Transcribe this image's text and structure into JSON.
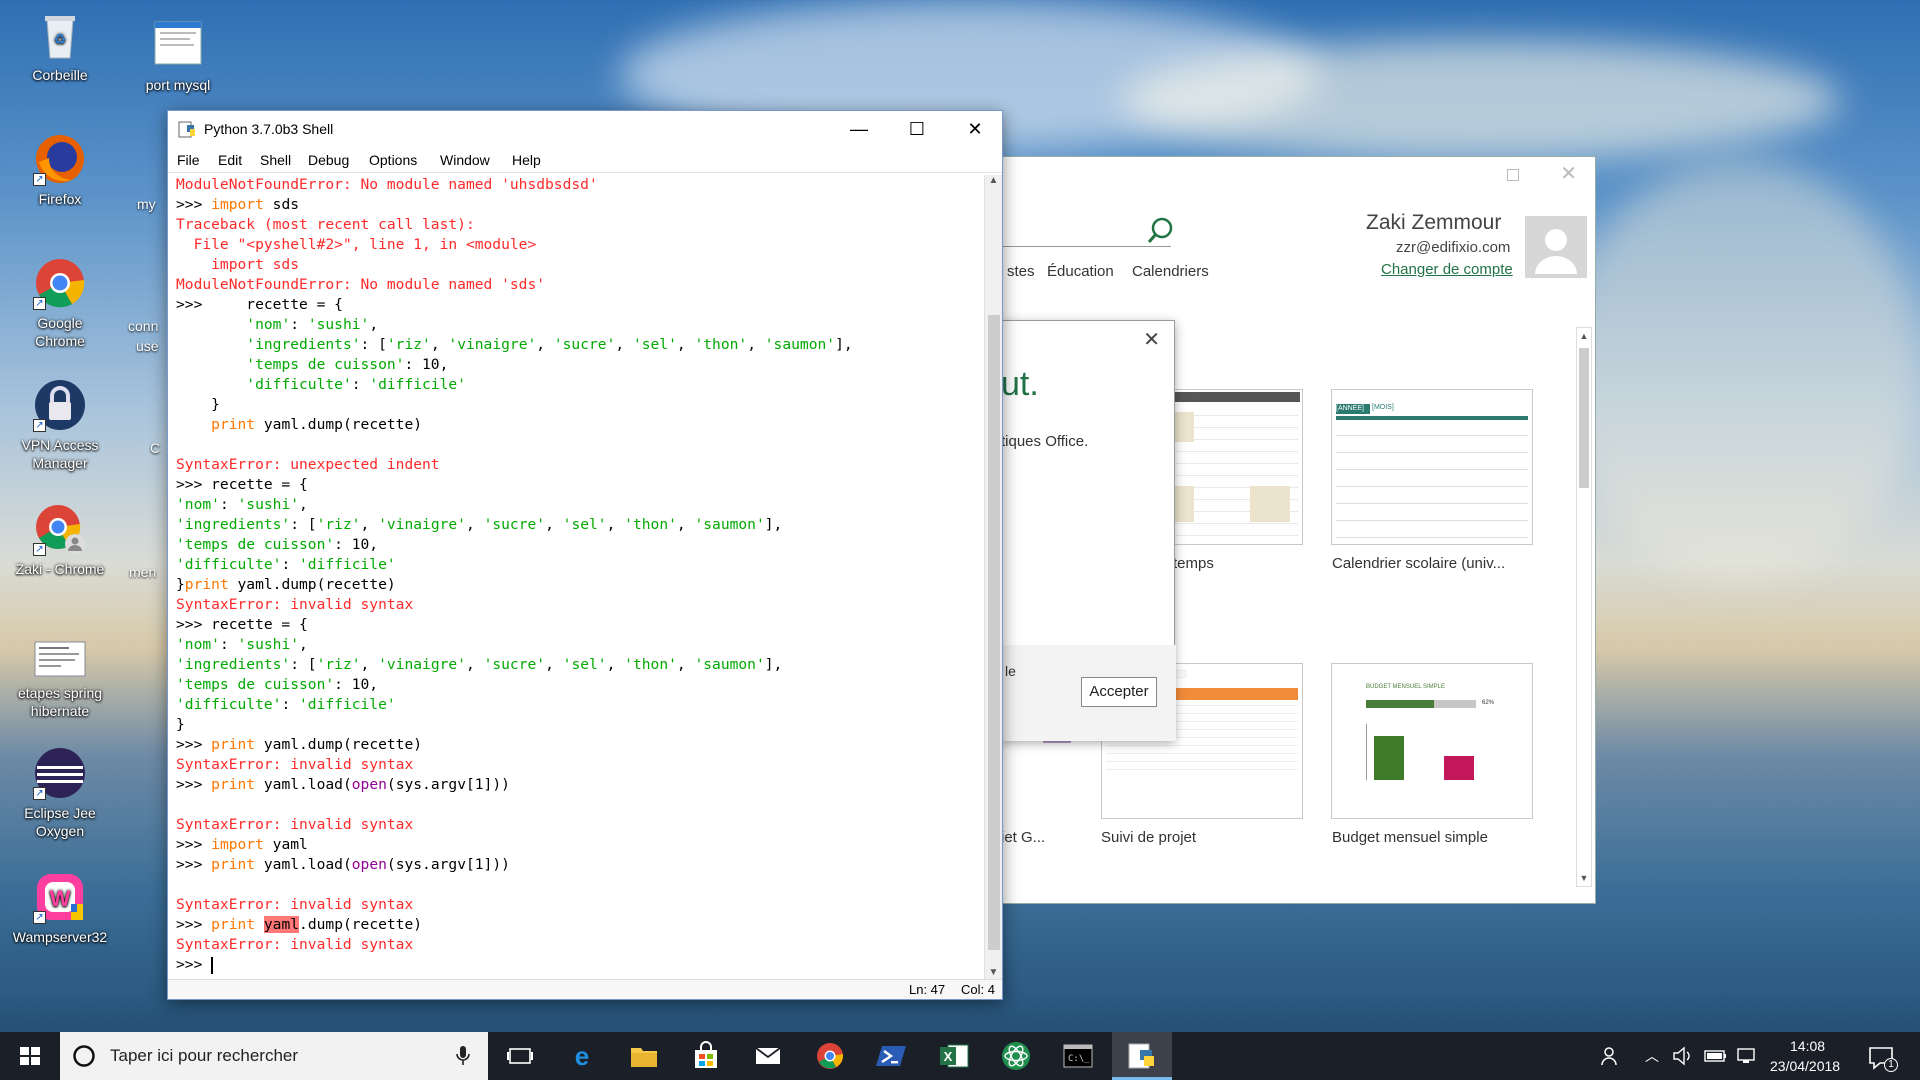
{
  "desktop": {
    "icons": [
      {
        "label": "Corbeille",
        "icon": "recycle-bin-icon"
      },
      {
        "label": "port mysql",
        "icon": "document-icon"
      },
      {
        "label": "Firefox",
        "icon": "firefox-icon"
      },
      {
        "label": "Google Chrome",
        "icon": "chrome-icon"
      },
      {
        "label": "VPN Access Manager",
        "icon": "lock-icon"
      },
      {
        "label": "Zaki - Chrome",
        "icon": "chrome-user-icon"
      },
      {
        "label": "etapes spring hibernate",
        "icon": "document-icon"
      },
      {
        "label": "Eclipse Jee Oxygen",
        "icon": "eclipse-icon"
      },
      {
        "label": "Wampserver32",
        "icon": "wampserver-icon"
      }
    ],
    "partial_labels": [
      "my",
      "conn",
      "use",
      "C",
      "men"
    ]
  },
  "excel": {
    "user_name": "Zaki Zemmour",
    "user_email": "zzr@edifixio.com",
    "change_account": "Changer de compte",
    "categories": [
      "stes",
      "Éducation",
      "Calendriers"
    ],
    "templates": [
      {
        "label": "temps"
      },
      {
        "label": "Calendrier scolaire (univ..."
      },
      {
        "label": "iet G..."
      },
      {
        "label": "Suivi de projet"
      },
      {
        "label": "Budget mensuel simple"
      }
    ],
    "calendar_header": [
      "[ANNÉE]",
      "[MOIS]"
    ],
    "budget_title": "BUDGET MENSUEL SIMPLE",
    "budget_percent": "62%"
  },
  "dialog": {
    "heading": "ut.",
    "body": "tiques Office.",
    "footer": "le",
    "accept_button": "Accepter"
  },
  "shell": {
    "title": "Python 3.7.0b3 Shell",
    "menu": [
      "File",
      "Edit",
      "Shell",
      "Debug",
      "Options",
      "Window",
      "Help"
    ],
    "status_line": "Ln: 47",
    "status_col": "Col: 4",
    "lines": [
      [
        [
          "red",
          "ModuleNotFoundError: No module named 'uhsdbsdsd'"
        ]
      ],
      [
        [
          "black",
          ">>> "
        ],
        [
          "kw",
          "import"
        ],
        [
          "black",
          " sds"
        ]
      ],
      [
        [
          "red",
          "Traceback (most recent call last):"
        ]
      ],
      [
        [
          "red",
          "  File \"<pyshell#2>\", line 1, in <module>"
        ]
      ],
      [
        [
          "red",
          "    import sds"
        ]
      ],
      [
        [
          "red",
          "ModuleNotFoundError: No module named 'sds'"
        ]
      ],
      [
        [
          "black",
          ">>>     recette = {"
        ]
      ],
      [
        [
          "black",
          "        "
        ],
        [
          "str",
          "'nom'"
        ],
        [
          "black",
          ": "
        ],
        [
          "str",
          "'sushi'"
        ],
        [
          "black",
          ","
        ]
      ],
      [
        [
          "black",
          "        "
        ],
        [
          "str",
          "'ingredients'"
        ],
        [
          "black",
          ": ["
        ],
        [
          "str",
          "'riz'"
        ],
        [
          "black",
          ", "
        ],
        [
          "str",
          "'vinaigre'"
        ],
        [
          "black",
          ", "
        ],
        [
          "str",
          "'sucre'"
        ],
        [
          "black",
          ", "
        ],
        [
          "str",
          "'sel'"
        ],
        [
          "black",
          ", "
        ],
        [
          "str",
          "'thon'"
        ],
        [
          "black",
          ", "
        ],
        [
          "str",
          "'saumon'"
        ],
        [
          "black",
          "],"
        ]
      ],
      [
        [
          "black",
          "        "
        ],
        [
          "str",
          "'temps de cuisson'"
        ],
        [
          "black",
          ": 10,"
        ]
      ],
      [
        [
          "black",
          "        "
        ],
        [
          "str",
          "'difficulte'"
        ],
        [
          "black",
          ": "
        ],
        [
          "str",
          "'difficile'"
        ]
      ],
      [
        [
          "black",
          "    }"
        ]
      ],
      [
        [
          "black",
          "    "
        ],
        [
          "kw",
          "print"
        ],
        [
          "black",
          " yaml.dump(recette)"
        ]
      ],
      [
        [
          "black",
          ""
        ]
      ],
      [
        [
          "red",
          "SyntaxError: unexpected indent"
        ]
      ],
      [
        [
          "black",
          ">>> recette = {"
        ]
      ],
      [
        [
          "str",
          "'nom'"
        ],
        [
          "black",
          ": "
        ],
        [
          "str",
          "'sushi'"
        ],
        [
          "black",
          ","
        ]
      ],
      [
        [
          "str",
          "'ingredients'"
        ],
        [
          "black",
          ": ["
        ],
        [
          "str",
          "'riz'"
        ],
        [
          "black",
          ", "
        ],
        [
          "str",
          "'vinaigre'"
        ],
        [
          "black",
          ", "
        ],
        [
          "str",
          "'sucre'"
        ],
        [
          "black",
          ", "
        ],
        [
          "str",
          "'sel'"
        ],
        [
          "black",
          ", "
        ],
        [
          "str",
          "'thon'"
        ],
        [
          "black",
          ", "
        ],
        [
          "str",
          "'saumon'"
        ],
        [
          "black",
          "],"
        ]
      ],
      [
        [
          "str",
          "'temps de cuisson'"
        ],
        [
          "black",
          ": 10,"
        ]
      ],
      [
        [
          "str",
          "'difficulte'"
        ],
        [
          "black",
          ": "
        ],
        [
          "str",
          "'difficile'"
        ]
      ],
      [
        [
          "black",
          "}"
        ],
        [
          "kw",
          "print"
        ],
        [
          "black",
          " yaml.dump(recette)"
        ]
      ],
      [
        [
          "red",
          "SyntaxError: invalid syntax"
        ]
      ],
      [
        [
          "black",
          ">>> recette = {"
        ]
      ],
      [
        [
          "str",
          "'nom'"
        ],
        [
          "black",
          ": "
        ],
        [
          "str",
          "'sushi'"
        ],
        [
          "black",
          ","
        ]
      ],
      [
        [
          "str",
          "'ingredients'"
        ],
        [
          "black",
          ": ["
        ],
        [
          "str",
          "'riz'"
        ],
        [
          "black",
          ", "
        ],
        [
          "str",
          "'vinaigre'"
        ],
        [
          "black",
          ", "
        ],
        [
          "str",
          "'sucre'"
        ],
        [
          "black",
          ", "
        ],
        [
          "str",
          "'sel'"
        ],
        [
          "black",
          ", "
        ],
        [
          "str",
          "'thon'"
        ],
        [
          "black",
          ", "
        ],
        [
          "str",
          "'saumon'"
        ],
        [
          "black",
          "],"
        ]
      ],
      [
        [
          "str",
          "'temps de cuisson'"
        ],
        [
          "black",
          ": 10,"
        ]
      ],
      [
        [
          "str",
          "'difficulte'"
        ],
        [
          "black",
          ": "
        ],
        [
          "str",
          "'difficile'"
        ]
      ],
      [
        [
          "black",
          "}"
        ]
      ],
      [
        [
          "black",
          ">>> "
        ],
        [
          "kw",
          "print"
        ],
        [
          "black",
          " yaml.dump(recette)"
        ]
      ],
      [
        [
          "red",
          "SyntaxError: invalid syntax"
        ]
      ],
      [
        [
          "black",
          ">>> "
        ],
        [
          "kw",
          "print"
        ],
        [
          "black",
          " yaml.load("
        ],
        [
          "bi",
          "open"
        ],
        [
          "black",
          "(sys.argv[1]))"
        ]
      ],
      [
        [
          "black",
          ""
        ]
      ],
      [
        [
          "red",
          "SyntaxError: invalid syntax"
        ]
      ],
      [
        [
          "black",
          ">>> "
        ],
        [
          "kw",
          "import"
        ],
        [
          "black",
          " yaml"
        ]
      ],
      [
        [
          "black",
          ">>> "
        ],
        [
          "kw",
          "print"
        ],
        [
          "black",
          " yaml.load("
        ],
        [
          "bi",
          "open"
        ],
        [
          "black",
          "(sys.argv[1]))"
        ]
      ],
      [
        [
          "black",
          ""
        ]
      ],
      [
        [
          "red",
          "SyntaxError: invalid syntax"
        ]
      ],
      [
        [
          "black",
          ">>> "
        ],
        [
          "kw",
          "print"
        ],
        [
          "black",
          " "
        ],
        [
          "hl",
          "yaml"
        ],
        [
          "black",
          ".dump(recette)"
        ]
      ],
      [
        [
          "red",
          "SyntaxError: invalid syntax"
        ]
      ],
      [
        [
          "black",
          ">>> "
        ]
      ]
    ]
  },
  "taskbar": {
    "search_placeholder": "Taper ici pour rechercher",
    "time": "14:08",
    "date": "23/04/2018",
    "notification_count": "1",
    "apps": [
      "task-view-icon",
      "edge-icon",
      "file-explorer-icon",
      "store-icon",
      "mail-icon",
      "chrome-icon",
      "powershell-icon",
      "excel-icon",
      "atom-icon",
      "cmd-icon",
      "python-idle-icon"
    ]
  },
  "colors": {
    "taskbar": "#1b1f27",
    "error": "#ff2a2a",
    "keyword": "#ff7700",
    "string": "#00aa00",
    "builtin": "#900090",
    "excel_green": "#217346"
  }
}
